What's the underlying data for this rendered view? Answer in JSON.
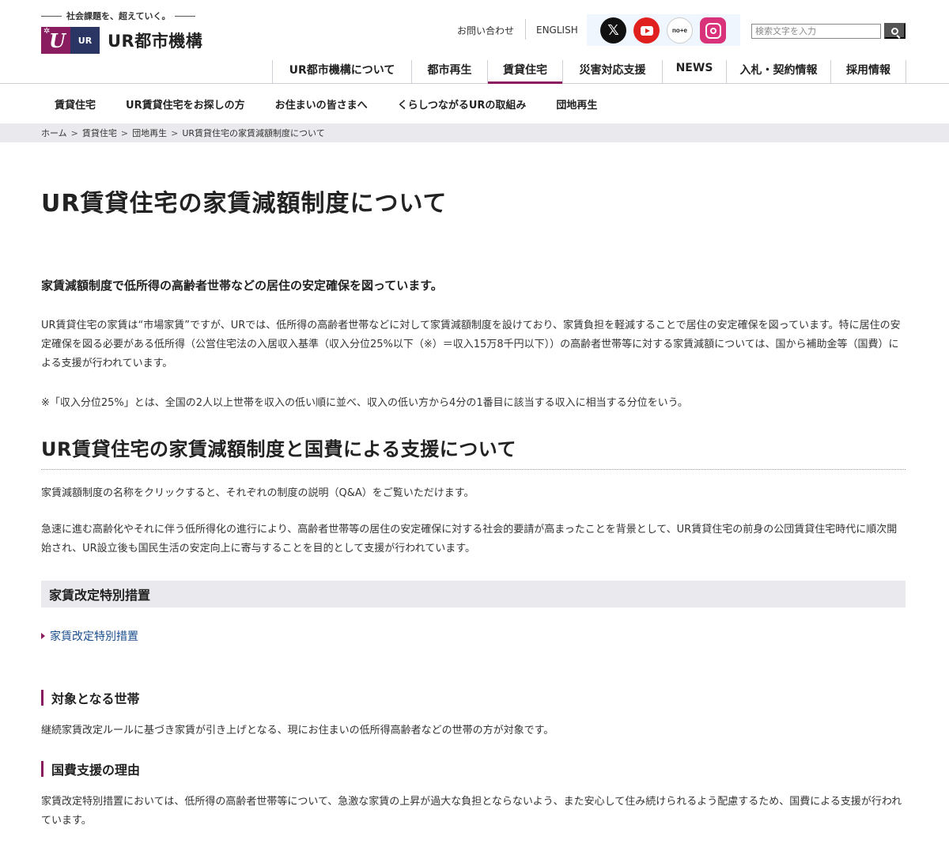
{
  "header": {
    "tagline": "社会課題を、超えていく。",
    "logo_mark_text": "UR",
    "logo_text": "UR都市機構",
    "contact_label": "お問い合わせ",
    "english_label": "ENGLISH",
    "sns": {
      "x_icon": "x-icon",
      "youtube_icon": "youtube-icon",
      "note_label": "no+e",
      "instagram_icon": "instagram-icon"
    },
    "search_placeholder": "検索文字を入力",
    "gnav": [
      {
        "label": "UR都市機構について"
      },
      {
        "label": "都市再生"
      },
      {
        "label": "賃貸住宅",
        "active": true
      },
      {
        "label": "災害対応支援"
      },
      {
        "label": "NEWS"
      },
      {
        "label": "入札・契約情報"
      },
      {
        "label": "採用情報"
      }
    ]
  },
  "subnav": [
    {
      "label": "賃貸住宅"
    },
    {
      "label": "UR賃貸住宅をお探しの方"
    },
    {
      "label": "お住まいの皆さまへ"
    },
    {
      "label": "くらしつながるURの取組み"
    },
    {
      "label": "団地再生"
    }
  ],
  "breadcrumb": [
    {
      "label": "ホーム"
    },
    {
      "label": "賃貸住宅"
    },
    {
      "label": "団地再生"
    },
    {
      "label": "UR賃貸住宅の家賃減額制度について"
    }
  ],
  "main": {
    "title": "UR賃貸住宅の家賃減額制度について",
    "lead": "家賃減額制度で低所得の高齢者世帯などの居住の安定確保を図っています。",
    "p1": "UR賃貸住宅の家賃は“市場家賃”ですが、URでは、低所得の高齢者世帯などに対して家賃減額制度を設けており、家賃負担を軽減することで居住の安定確保を図っています。特に居住の安定確保を図る必要がある低所得（公営住宅法の入居収入基準（収入分位25%以下（※）＝収入15万8千円以下））の高齢者世帯等に対する家賃減額については、国から補助金等（国費）による支援が行われています。",
    "p2": "※「収入分位25%」とは、全国の2人以上世帯を収入の低い順に並べ、収入の低い方から4分の1番目に該当する収入に相当する分位をいう。",
    "h2": "UR賃貸住宅の家賃減額制度と国費による支援について",
    "p3": "家賃減額制度の名称をクリックすると、それぞれの制度の説明（Q&A）をご覧いただけます。",
    "p4": "急速に進む高齢化やそれに伴う低所得化の進行により、高齢者世帯等の居住の安定確保に対する社会的要請が高まったことを背景として、UR賃貸住宅の前身の公団賃貸住宅時代に順次開始され、UR設立後も国民生活の安定向上に寄与することを目的として支援が行われています。",
    "h3": "家賃改定特別措置",
    "link": "家賃改定特別措置",
    "h4a": "対象となる世帯",
    "p5": "継続家賃改定ルールに基づき家賃が引き上げとなる、現にお住まいの低所得高齢者などの世帯の方が対象です。",
    "h4b": "国費支援の理由",
    "p6": "家賃改定特別措置においては、低所得の高齢者世帯等について、急激な家賃の上昇が過大な負担とならないよう、また安心して住み続けられるよう配慮するため、国費による支援が行われています。"
  },
  "colors": {
    "brand": "#8a1d5f",
    "navy": "#2a3564",
    "link": "#1a4d8c",
    "band": "#eaeaee"
  }
}
